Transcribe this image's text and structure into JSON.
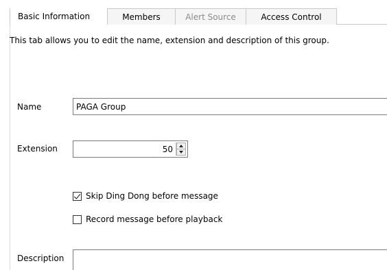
{
  "tabs": [
    {
      "label": "Basic Information",
      "active": true,
      "disabled": false
    },
    {
      "label": "Members",
      "active": false,
      "disabled": false
    },
    {
      "label": "Alert Source",
      "active": false,
      "disabled": true
    },
    {
      "label": "Access Control",
      "active": false,
      "disabled": false
    }
  ],
  "panel": {
    "description": "This tab allows you to edit the name, extension and description of this group."
  },
  "form": {
    "name_label": "Name",
    "name_value": "PAGA Group",
    "extension_label": "Extension",
    "extension_value": "50",
    "skip_ding_dong_label": "Skip Ding Dong before message",
    "skip_ding_dong_checked": true,
    "record_message_label": "Record message before playback",
    "record_message_checked": false,
    "description_label": "Description",
    "description_value": ""
  },
  "icons": {
    "spin_up": "spin-up-icon",
    "spin_down": "spin-down-icon",
    "checkmark": "checkmark-icon"
  },
  "colors": {
    "border": "#c9c9c9",
    "disabled_text": "#8a8a8a",
    "input_border": "#7a7a7a"
  }
}
